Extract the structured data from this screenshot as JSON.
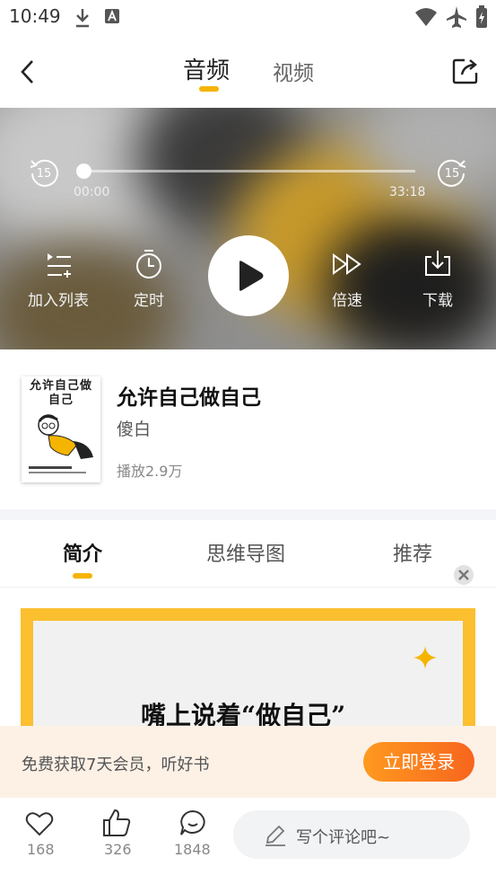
{
  "status": {
    "time": "10:49"
  },
  "nav": {
    "tab_audio": "音频",
    "tab_video": "视频"
  },
  "player": {
    "elapsed": "00:00",
    "duration": "33:18",
    "skip_back": "15",
    "skip_forward": "15",
    "progress": 0,
    "add_to_list": "加入列表",
    "timer": "定时",
    "speed": "倍速",
    "download": "下载"
  },
  "book": {
    "title": "允许自己做自己",
    "author": "傻白",
    "plays": "播放2.9万",
    "cover_title": "允许自己做自己"
  },
  "content_tabs": {
    "intro": "简介",
    "mindmap": "思维导图",
    "recommend": "推荐"
  },
  "article": {
    "headline": "嘴上说着“做自己”"
  },
  "promo": {
    "text": "免费获取7天会员，听好书",
    "button": "立即登录"
  },
  "bottom": {
    "likes": "168",
    "thumbs": "326",
    "comments": "1848",
    "comment_placeholder": "写个评论吧~"
  },
  "colors": {
    "accent": "#f5b400",
    "promo_button": "#f7651d"
  }
}
